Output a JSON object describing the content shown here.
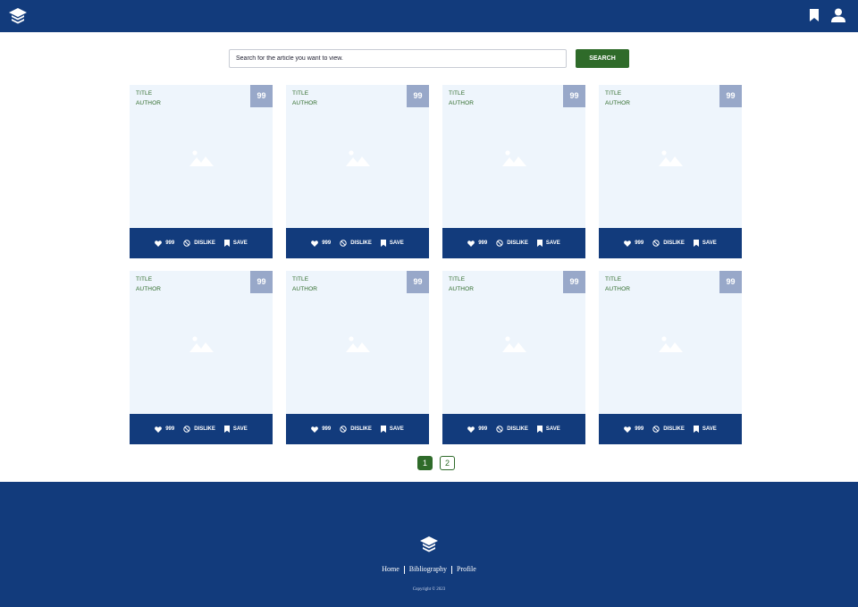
{
  "header": {
    "logo_icon": "graduation-cap-icon",
    "bookmark_icon": "bookmark-icon",
    "user_icon": "user-icon"
  },
  "search": {
    "placeholder": "Search for the article you want to view.",
    "button_label": "SEARCH"
  },
  "cards": [
    {
      "title": "TITLE",
      "author": "AUTHOR",
      "score": "99",
      "likes": "999",
      "dislike_label": "DISLIKE",
      "save_label": "SAVE"
    },
    {
      "title": "TITLE",
      "author": "AUTHOR",
      "score": "99",
      "likes": "999",
      "dislike_label": "DISLIKE",
      "save_label": "SAVE"
    },
    {
      "title": "TITLE",
      "author": "AUTHOR",
      "score": "99",
      "likes": "999",
      "dislike_label": "DISLIKE",
      "save_label": "SAVE"
    },
    {
      "title": "TITLE",
      "author": "AUTHOR",
      "score": "99",
      "likes": "999",
      "dislike_label": "DISLIKE",
      "save_label": "SAVE"
    },
    {
      "title": "TITLE",
      "author": "AUTHOR",
      "score": "99",
      "likes": "999",
      "dislike_label": "DISLIKE",
      "save_label": "SAVE"
    },
    {
      "title": "TITLE",
      "author": "AUTHOR",
      "score": "99",
      "likes": "999",
      "dislike_label": "DISLIKE",
      "save_label": "SAVE"
    },
    {
      "title": "TITLE",
      "author": "AUTHOR",
      "score": "99",
      "likes": "999",
      "dislike_label": "DISLIKE",
      "save_label": "SAVE"
    },
    {
      "title": "TITLE",
      "author": "AUTHOR",
      "score": "99",
      "likes": "999",
      "dislike_label": "DISLIKE",
      "save_label": "SAVE"
    }
  ],
  "pagination": {
    "pages": [
      "1",
      "2"
    ],
    "current": "1"
  },
  "footer": {
    "links": [
      "Home",
      "Bibliography",
      "Profile"
    ],
    "copyright": "Copyright © 2023"
  },
  "colors": {
    "primary": "#123b7c",
    "accent": "#2f6b2a",
    "card_bg": "#eef5fc",
    "score_bg": "#98a8c9"
  }
}
